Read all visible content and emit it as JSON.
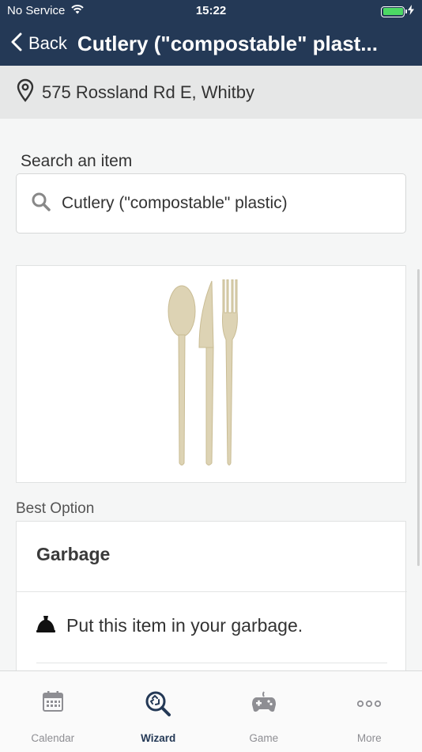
{
  "status_bar": {
    "carrier": "No Service",
    "time": "15:22"
  },
  "nav": {
    "back_label": "Back",
    "title": "Cutlery (\"compostable\" plast..."
  },
  "address": {
    "text": "575 Rossland Rd E, Whitby"
  },
  "search": {
    "label": "Search an item",
    "value": "Cutlery (\"compostable\" plastic)"
  },
  "result": {
    "best_label": "Best Option",
    "option_title": "Garbage",
    "option_text": "Put this item in your garbage."
  },
  "tabs": [
    {
      "label": "Calendar",
      "icon": "calendar-icon"
    },
    {
      "label": "Wizard",
      "icon": "wizard-search-icon"
    },
    {
      "label": "Game",
      "icon": "gamepad-icon"
    },
    {
      "label": "More",
      "icon": "more-dots-icon"
    }
  ],
  "colors": {
    "header": "#243956",
    "active_tab": "#243956",
    "battery": "#4cd964"
  }
}
